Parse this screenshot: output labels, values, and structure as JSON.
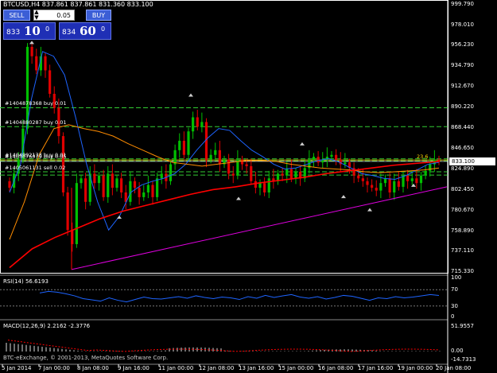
{
  "header": {
    "symbol": "BTCUSD,H4",
    "ohlc": "837.861 837.861 831.360 833.100"
  },
  "trade_panel": {
    "sell_label": "SELL",
    "buy_label": "BUY",
    "lot_value": "0.05",
    "sell_price_small": "833",
    "sell_price_big": "10",
    "sell_price_sup": "0",
    "buy_price_small": "834",
    "buy_price_big": "60",
    "buy_price_sup": "0"
  },
  "price_axis": [
    "999.790",
    "978.010",
    "956.230",
    "934.790",
    "912.670",
    "890.220",
    "868.440",
    "846.650",
    "824.890",
    "802.450",
    "780.670",
    "758.890",
    "737.110",
    "715.330"
  ],
  "current_price": "833.100",
  "orders": [
    {
      "label": "#1404878368 buy 0.01"
    },
    {
      "label": "#1404880287 buy 0.01"
    },
    {
      "label": "#1404992173 buy 0.01"
    },
    {
      "label": "#1405076079 buy 0.05"
    },
    {
      "label": "#1405061131 sell 0.02"
    }
  ],
  "annotation": "23.6",
  "rsi": {
    "label": "RSI(14) 56.6193",
    "levels": [
      "100",
      "70",
      "30",
      "0"
    ]
  },
  "macd": {
    "label": "MACD(12,26,9) 2.2162 -2.3776",
    "levels": [
      "51.9557",
      "0.00",
      "-14.7313"
    ]
  },
  "copyright": "BTC-eExchange, © 2001-2013, MetaQuotes Software Corp.",
  "time_axis": [
    "5 Jan 2014",
    "7 Jan 00:00",
    "8 Jan 08:00",
    "9 Jan 16:00",
    "11 Jan 00:00",
    "12 Jan 08:00",
    "13 Jan 16:00",
    "15 Jan 00:00",
    "16 Jan 08:00",
    "17 Jan 16:00",
    "19 Jan 00:00",
    "20 Jan 08:00"
  ],
  "colors": {
    "bull": "#00c000",
    "bear": "#e00000",
    "ma_fast": "#1e64ff",
    "ma_slow": "#ff8c00",
    "ma_long": "#ff0000",
    "trend": "#e000e0",
    "order_line": "#33cc33",
    "rsi": "#1e64ff",
    "macd": "#ff0000"
  }
}
